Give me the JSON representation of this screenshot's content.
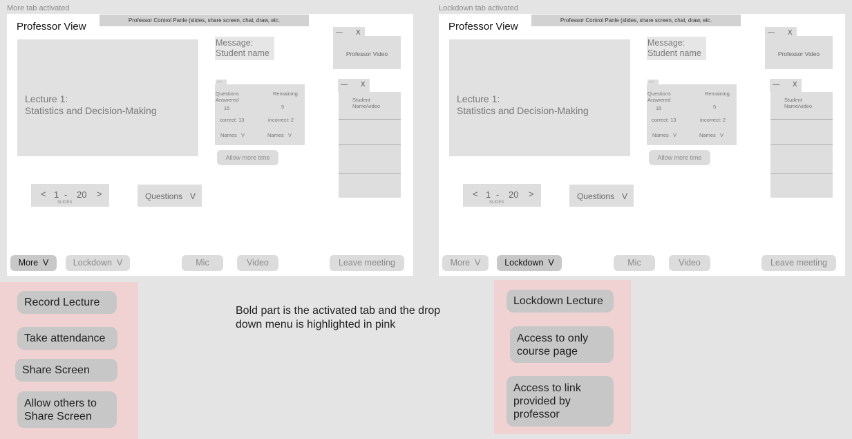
{
  "left": {
    "caption": "More tab activated",
    "control_panel": "Professor Control Panle (slides, share screen, chat, draw, etc.",
    "title": "Professor View",
    "lecture_line1": "Lecture 1:",
    "lecture_line2": "Statistics and Decision-Making",
    "message_line1": "Message:",
    "message_line2": "Student name",
    "prof_win_minimize": "—",
    "prof_win_close": "X",
    "prof_video": "Professor Video",
    "stats_handle": "—",
    "questions_answered": "Questions Answered",
    "remaining": "Remaining",
    "answered_count": "15",
    "remaining_count": "5",
    "correct": "correct: 13",
    "incorrect": "incorrect: 2",
    "names_a": "Names",
    "names_b": "Names",
    "chev": "V",
    "allow_more_time": "Allow more time",
    "stud_win_minimize": "—",
    "stud_win_close": "X",
    "student_video": "Student Name/video",
    "slide_prev": "<",
    "slide_current": "1",
    "slide_sep": "-",
    "slide_total": "20",
    "slide_next": ">",
    "slides_label": "SLIDES",
    "questions": "Questions",
    "more": "More",
    "lockdown": "Lockdown",
    "mic": "Mic",
    "video": "Video",
    "leave": "Leave meeting"
  },
  "right": {
    "caption": "Lockdown tab activated",
    "control_panel": "Professor Control Panle (slides, share screen, chat, draw, etc.",
    "title": "Professor View",
    "lecture_line1": "Lecture 1:",
    "lecture_line2": "Statistics and Decision-Making",
    "message_line1": "Message:",
    "message_line2": "Student name",
    "prof_win_minimize": "—",
    "prof_win_close": "X",
    "prof_video": "Professor Video",
    "stats_handle": "—",
    "questions_answered": "Questions Answered",
    "remaining": "Remaining",
    "answered_count": "15",
    "remaining_count": "5",
    "correct": "correct: 13",
    "incorrect": "incorrect: 2",
    "names_a": "Names",
    "names_b": "Names",
    "chev": "V",
    "allow_more_time": "Allow more time",
    "stud_win_minimize": "—",
    "stud_win_close": "X",
    "student_video": "Student Name/video",
    "slide_prev": "<",
    "slide_current": "1",
    "slide_sep": "-",
    "slide_total": "20",
    "slide_next": ">",
    "slides_label": "SLIDES",
    "questions": "Questions",
    "more": "More",
    "lockdown": "Lockdown",
    "mic": "Mic",
    "video": "Video",
    "leave": "Leave meeting"
  },
  "more_menu": [
    "Record Lecture",
    "Take attendance",
    "Share Screen",
    "Allow others to Share Screen"
  ],
  "lockdown_menu": [
    "Lockdown Lecture",
    "Access to only course page",
    "Access to link provided by professor"
  ],
  "note": "Bold part is the activated tab and the drop down menu is highlighted in pink",
  "colors": {
    "menu_highlight": "#f0d2d2",
    "active_tab": "#c8c8c8"
  }
}
